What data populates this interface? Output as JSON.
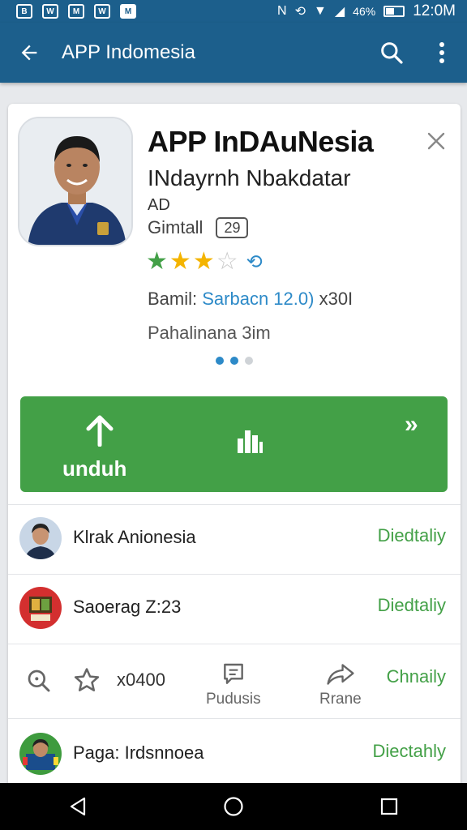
{
  "status_bar": {
    "notifications": [
      "B",
      "W",
      "M",
      "W",
      "M"
    ],
    "signal_icons": [
      "nfc-icon",
      "sync-icon",
      "wifi-icon",
      "signal-icon"
    ],
    "battery_pct": "46%",
    "battery_level": 0.46,
    "time": "12:0M"
  },
  "app_bar": {
    "title": "APP Indomesia"
  },
  "app": {
    "title": "APP InDAuNesia",
    "developer": "INdayrnh Nbakdatar",
    "category": "AD",
    "size": "Gimtall",
    "age_rating": "29",
    "rating": 3.5,
    "version_label": "Bamil:",
    "version_link": "Sarbacn 12.0)",
    "version_extra": "x30I",
    "extra_info": "Pahalinana 3im"
  },
  "carousel": {
    "count": 3,
    "active": 0
  },
  "install": {
    "label": "unduh"
  },
  "list": [
    {
      "name": "Klrak Anionesia",
      "status": "Diedtaliy"
    },
    {
      "name": "Saoerag Z:23",
      "status": "Diedtaliy"
    }
  ],
  "actions": {
    "count": "x0400",
    "preview_label": "Pudusis",
    "share_label": "Rrane",
    "status": "Chnaily"
  },
  "bottom_item": {
    "name": "Paga: Irdsnnoea",
    "status": "Diectahly"
  },
  "colors": {
    "primary": "#1c5f8c",
    "install_green": "#43a047",
    "link_blue": "#2d8ac8",
    "star_green": "#43a047",
    "star_gold": "#f4b400"
  }
}
